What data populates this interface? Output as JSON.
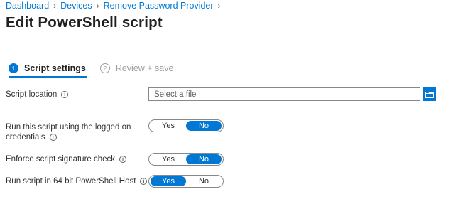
{
  "breadcrumb": [
    "Dashboard",
    "Devices",
    "Remove Password Provider"
  ],
  "page_title": "Edit PowerShell script",
  "steps": [
    {
      "num": "1",
      "label": "Script settings",
      "active": true
    },
    {
      "num": "2",
      "label": "Review + save",
      "active": false
    }
  ],
  "script_location": {
    "label": "Script location",
    "placeholder": "Select a file",
    "browse_icon": "folder-icon"
  },
  "run_logged_on": {
    "label_line1": "Run this script using the logged on",
    "label_line2": "credentials",
    "options": [
      "Yes",
      "No"
    ],
    "selected": "No"
  },
  "enforce_signature": {
    "label": "Enforce script signature check",
    "options": [
      "Yes",
      "No"
    ],
    "selected": "No"
  },
  "run_64bit": {
    "label": "Run script in 64 bit PowerShell Host",
    "options": [
      "Yes",
      "No"
    ],
    "selected": "Yes"
  },
  "info_glyph": "i",
  "colors": {
    "accent": "#0078d4",
    "text": "#323130",
    "muted": "#a19f9d"
  }
}
